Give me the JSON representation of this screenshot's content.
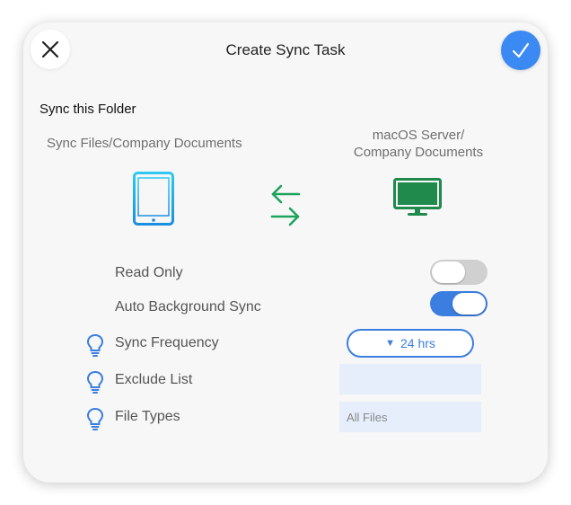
{
  "dialog": {
    "title": "Create Sync Task",
    "close_icon": "close-icon",
    "confirm_icon": "checkmark-icon",
    "accent_color": "#3b8af3"
  },
  "folder": {
    "section_title": "Sync this Folder",
    "source_path": "Sync Files/Company Documents",
    "dest_line1": "macOS Server/",
    "dest_line2": "Company Documents",
    "source_icon": "tablet-icon",
    "sync_icon": "sync-arrows-icon",
    "dest_icon": "monitor-icon"
  },
  "options": {
    "read_only": {
      "label": "Read Only",
      "enabled": false
    },
    "auto_sync": {
      "label": "Auto Background Sync",
      "enabled": true
    },
    "frequency": {
      "label": "Sync Frequency",
      "value": "24 hrs",
      "hint_icon": "lightbulb-icon"
    },
    "exclude": {
      "label": "Exclude List",
      "value": "",
      "hint_icon": "lightbulb-icon"
    },
    "file_types": {
      "label": "File Types",
      "value": "All Files",
      "hint_icon": "lightbulb-icon"
    }
  }
}
